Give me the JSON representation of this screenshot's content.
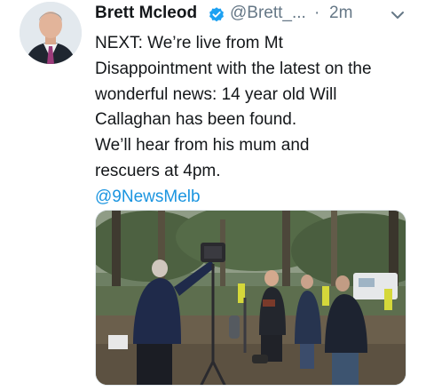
{
  "tweet": {
    "author_name": "Brett Mcleod",
    "handle": "@Brett_...",
    "separator": "·",
    "time": "2m",
    "text_lines": [
      "NEXT: We’re live from Mt",
      "Disappointment with the latest on the",
      "wonderful news: 14 year old Will",
      "Callaghan has been found.",
      "We’ll hear from his mum and",
      "rescuers at 4pm."
    ],
    "mention": "@9NewsMelb"
  },
  "icons": {
    "verified": "verified-badge-icon",
    "menu": "chevron-down-icon"
  },
  "colors": {
    "text": "#14171a",
    "secondary": "#657786",
    "link": "#1b95e0",
    "verified": "#1da1f2"
  }
}
